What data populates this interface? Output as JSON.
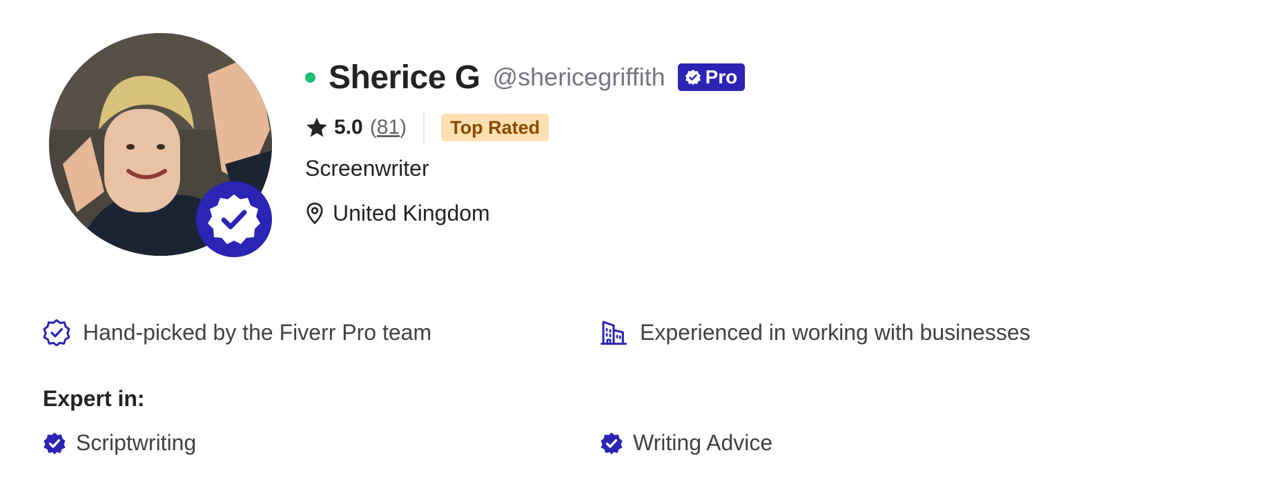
{
  "profile": {
    "name": "Sherice G",
    "username": "@shericegriffith",
    "pro_label": "Pro",
    "online": true,
    "rating": "5.0",
    "reviews_open": "(",
    "reviews_count": "81",
    "reviews_close": ")",
    "top_rated_label": "Top Rated",
    "role": "Screenwriter",
    "location": "United Kingdom"
  },
  "features": [
    {
      "icon": "verified-shield-icon",
      "label": "Hand-picked by the Fiverr Pro team"
    },
    {
      "icon": "building-icon",
      "label": "Experienced in working with businesses"
    }
  ],
  "expertise": {
    "title": "Expert in:",
    "items": [
      "Scriptwriting",
      "Writing Advice"
    ]
  },
  "colors": {
    "pro_blue": "#2b24b5",
    "online_green": "#1dbf73",
    "top_rated_bg": "#ffe0b3",
    "top_rated_text": "#8a4b00"
  }
}
